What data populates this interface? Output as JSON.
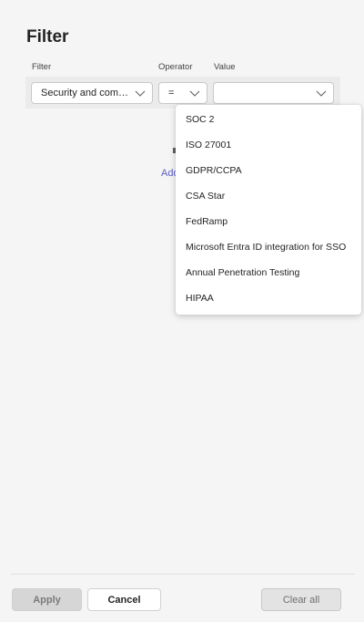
{
  "panel": {
    "title": "Filter"
  },
  "columns": {
    "filter": "Filter",
    "operator": "Operator",
    "value": "Value"
  },
  "row": {
    "filter_value": "Security and compl...",
    "operator_value": "=",
    "value_value": ""
  },
  "add_link": "Add",
  "dropdown": {
    "options": [
      "SOC 2",
      "ISO 27001",
      "GDPR/CCPA",
      "CSA Star",
      "FedRamp",
      "Microsoft Entra ID integration for SSO",
      "Annual Penetration Testing",
      "HIPAA"
    ]
  },
  "footer": {
    "apply": "Apply",
    "cancel": "Cancel",
    "clear_all": "Clear all"
  },
  "colors": {
    "accent_link": "#5b5fc7",
    "panel_bg": "#f5f5f5"
  }
}
